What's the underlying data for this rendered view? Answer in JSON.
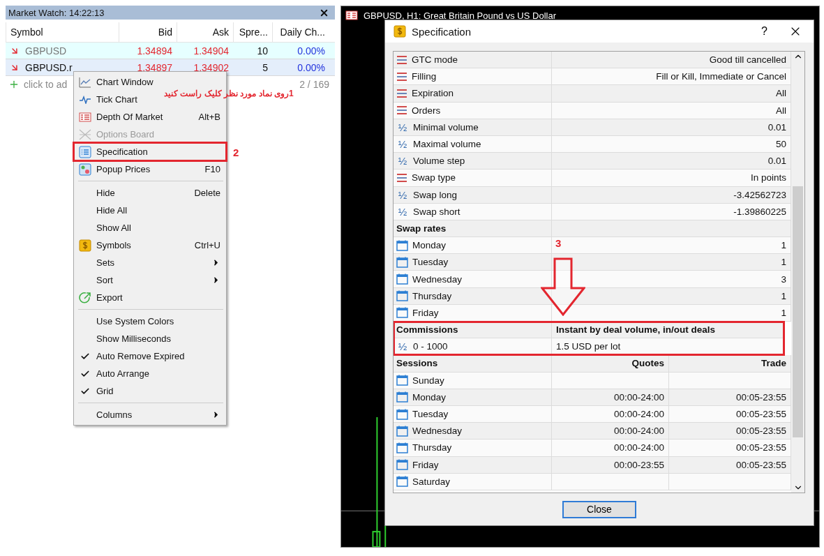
{
  "market_watch": {
    "title": "Market Watch: 14:22:13",
    "columns": [
      "Symbol",
      "Bid",
      "Ask",
      "Spre...",
      "Daily Ch..."
    ],
    "rows": [
      {
        "symbol": "GBPUSD",
        "bid": "1.34894",
        "ask": "1.34904",
        "spread": "10",
        "daily_change": "0.00%",
        "selected": false
      },
      {
        "symbol": "GBPUSD.r",
        "bid": "1.34897",
        "ask": "1.34902",
        "spread": "5",
        "daily_change": "0.00%",
        "selected": true
      }
    ],
    "add_label": "click to ad",
    "count": "2 / 169"
  },
  "context_menu": {
    "groups": [
      {
        "items": [
          {
            "label": "Chart Window",
            "submenu": false,
            "checked": false,
            "disabled": false,
            "highlighted": false
          },
          {
            "label": "Tick Chart",
            "submenu": false,
            "checked": false,
            "disabled": false,
            "highlighted": false
          },
          {
            "label": "Depth Of Market",
            "shortcut": "Alt+B",
            "submenu": false,
            "checked": false,
            "disabled": false,
            "highlighted": false
          },
          {
            "label": "Options Board",
            "submenu": false,
            "checked": false,
            "disabled": true,
            "highlighted": false
          },
          {
            "label": "Specification",
            "submenu": false,
            "checked": false,
            "disabled": false,
            "highlighted": true
          },
          {
            "label": "Popup Prices",
            "shortcut": "F10",
            "submenu": false,
            "checked": false,
            "disabled": false,
            "highlighted": false
          }
        ]
      },
      {
        "items": [
          {
            "label": "Hide",
            "shortcut": "Delete",
            "submenu": false,
            "checked": false,
            "disabled": false,
            "highlighted": false
          },
          {
            "label": "Hide All",
            "submenu": false,
            "checked": false,
            "disabled": false,
            "highlighted": false
          },
          {
            "label": "Show All",
            "submenu": false,
            "checked": false,
            "disabled": false,
            "highlighted": false
          },
          {
            "label": "Symbols",
            "shortcut": "Ctrl+U",
            "submenu": false,
            "checked": false,
            "disabled": false,
            "highlighted": false
          },
          {
            "label": "Sets",
            "submenu": true,
            "checked": false,
            "disabled": false,
            "highlighted": false
          },
          {
            "label": "Sort",
            "submenu": true,
            "checked": false,
            "disabled": false,
            "highlighted": false
          },
          {
            "label": "Export",
            "submenu": false,
            "checked": false,
            "disabled": false,
            "highlighted": false
          }
        ]
      },
      {
        "items": [
          {
            "label": "Use System Colors",
            "submenu": false,
            "checked": false,
            "disabled": false,
            "highlighted": false
          },
          {
            "label": "Show Milliseconds",
            "submenu": false,
            "checked": false,
            "disabled": false,
            "highlighted": false
          },
          {
            "label": "Auto Remove Expired",
            "submenu": false,
            "checked": true,
            "disabled": false,
            "highlighted": false
          },
          {
            "label": "Auto Arrange",
            "submenu": false,
            "checked": true,
            "disabled": false,
            "highlighted": false
          },
          {
            "label": "Grid",
            "submenu": false,
            "checked": true,
            "disabled": false,
            "highlighted": false
          }
        ]
      },
      {
        "items": [
          {
            "label": "Columns",
            "submenu": true,
            "checked": false,
            "disabled": false,
            "highlighted": false
          }
        ]
      }
    ]
  },
  "annotations": {
    "step_1": "1روی نماد مورد نظر کلیک راست کنید",
    "step_2": "2",
    "step_3": "3"
  },
  "chart": {
    "title": "GBPUSD, H1: Great Britain Pound vs US Dollar"
  },
  "dialog": {
    "title": "Specification",
    "help": "?",
    "close_button": "Close",
    "rows": [
      {
        "kind": "setting",
        "label": "GTC mode",
        "value": "Good till cancelled",
        "boxed": false
      },
      {
        "kind": "setting",
        "label": "Filling",
        "value": "Fill or Kill, Immediate or Cancel",
        "boxed": false
      },
      {
        "kind": "setting",
        "label": "Expiration",
        "value": "All",
        "boxed": false
      },
      {
        "kind": "setting",
        "label": "Orders",
        "value": "All",
        "boxed": false
      },
      {
        "kind": "volume",
        "glyph": "½",
        "label": "Minimal volume",
        "value": "0.01",
        "boxed": false
      },
      {
        "kind": "volume",
        "glyph": "½",
        "label": "Maximal volume",
        "value": "50",
        "boxed": false
      },
      {
        "kind": "volume",
        "glyph": "½",
        "label": "Volume step",
        "value": "0.01",
        "boxed": false
      },
      {
        "kind": "setting",
        "label": "Swap type",
        "value": "In points",
        "boxed": false
      },
      {
        "kind": "volume",
        "glyph": "½",
        "label": "Swap long",
        "value": "-3.42562723",
        "boxed": false
      },
      {
        "kind": "volume",
        "glyph": "½",
        "label": "Swap short",
        "value": "-1.39860225",
        "boxed": false
      },
      {
        "kind": "header",
        "label": "Swap rates",
        "boxed": false
      },
      {
        "kind": "day",
        "label": "Monday",
        "value": "1",
        "boxed": false
      },
      {
        "kind": "day",
        "label": "Tuesday",
        "value": "1",
        "boxed": false
      },
      {
        "kind": "day",
        "label": "Wednesday",
        "value": "3",
        "boxed": false
      },
      {
        "kind": "day",
        "label": "Thursday",
        "value": "1",
        "boxed": false
      },
      {
        "kind": "day",
        "label": "Friday",
        "value": "1",
        "boxed": false
      },
      {
        "kind": "header",
        "label": "Commissions",
        "value": "Instant by deal volume, in/out deals",
        "boxed": true
      },
      {
        "kind": "tier",
        "glyph": "½",
        "label": "0 - 1000",
        "value": "1.5 USD per lot",
        "boxed": true
      },
      {
        "kind": "sessions_header",
        "label": "Sessions",
        "quotes": "Quotes",
        "trade": "Trade",
        "boxed": false
      },
      {
        "kind": "session",
        "label": "Sunday",
        "boxed": false
      },
      {
        "kind": "session",
        "label": "Monday",
        "quotes": "00:00-24:00",
        "trade": "00:05-23:55",
        "boxed": false
      },
      {
        "kind": "session",
        "label": "Tuesday",
        "quotes": "00:00-24:00",
        "trade": "00:05-23:55",
        "boxed": false
      },
      {
        "kind": "session",
        "label": "Wednesday",
        "quotes": "00:00-24:00",
        "trade": "00:05-23:55",
        "boxed": false
      },
      {
        "kind": "session",
        "label": "Thursday",
        "quotes": "00:00-24:00",
        "trade": "00:05-23:55",
        "boxed": false
      },
      {
        "kind": "session",
        "label": "Friday",
        "quotes": "00:00-23:55",
        "trade": "00:05-23:55",
        "boxed": false
      },
      {
        "kind": "session",
        "label": "Saturday",
        "boxed": false
      }
    ]
  }
}
